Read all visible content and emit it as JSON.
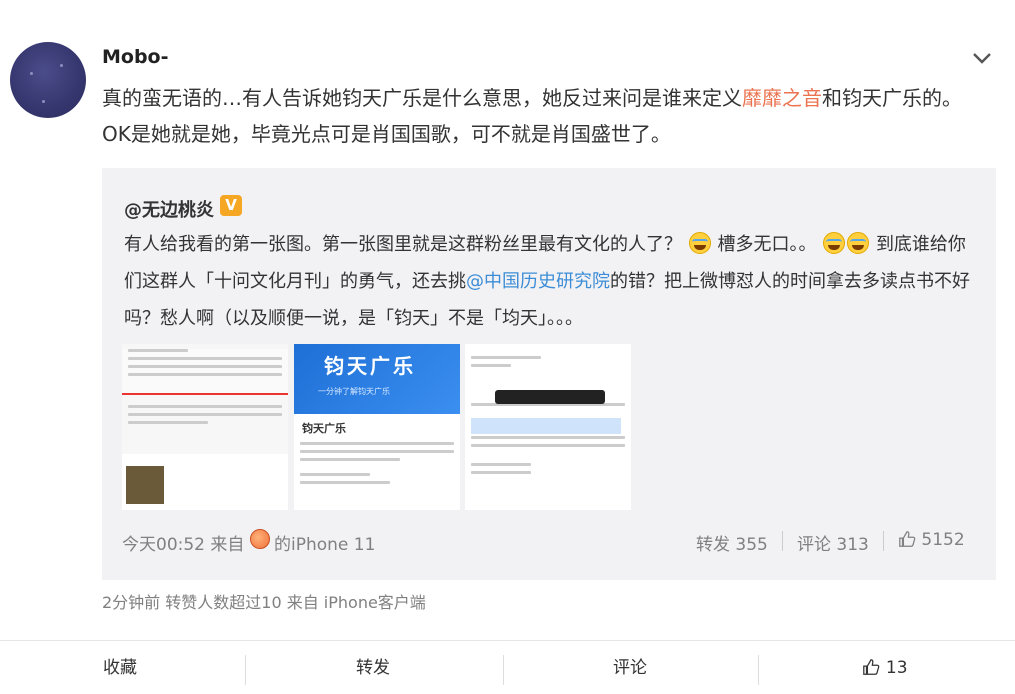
{
  "post": {
    "username": "Mobo-",
    "text_before": "真的蛮无语的…有人告诉她钧天广乐是什么意思，她反过来问是谁来定义",
    "text_highlight": "靡靡之音",
    "text_after": "和钧天广乐的。OK是她就是她，毕竟光点可是肖国国歌，可不就是肖国盛世了。"
  },
  "repost": {
    "username": "@无边桃炎",
    "badge": "V",
    "text_1": "有人给我看的第一张图。第一张图里就是这群粉丝里最有文化的人了？",
    "text_2": "槽多无口。。",
    "text_3": "到底谁给你们这群人「十问文化月刊」的勇气，还去挑",
    "mention": "@中国历史研究院",
    "text_4": "的错？把上微博怼人的时间拿去多读点书不好吗？愁人啊（以及顺便一说，是「钧天」不是「均天」。。。",
    "thumbnails": {
      "thumb2_title": "钧天广乐",
      "thumb2_sub": "一分钟了解钧天广乐",
      "thumb2_name": "钧天广乐"
    },
    "meta": {
      "time": "今天00:52 来自",
      "device": "的iPhone 11",
      "forward": "转发 355",
      "comment": "评论 313",
      "likes": "5152"
    }
  },
  "footer_meta": "2分钟前 转赞人数超过10 来自 iPhone客户端",
  "actions": {
    "favorite": "收藏",
    "forward": "转发",
    "comment": "评论",
    "like_count": "13"
  },
  "icons": {
    "more": "chevron-down-icon",
    "like": "thumbs-up-icon",
    "emoji": "laugh-cry-emoji-icon",
    "peach": "peach-icon"
  }
}
